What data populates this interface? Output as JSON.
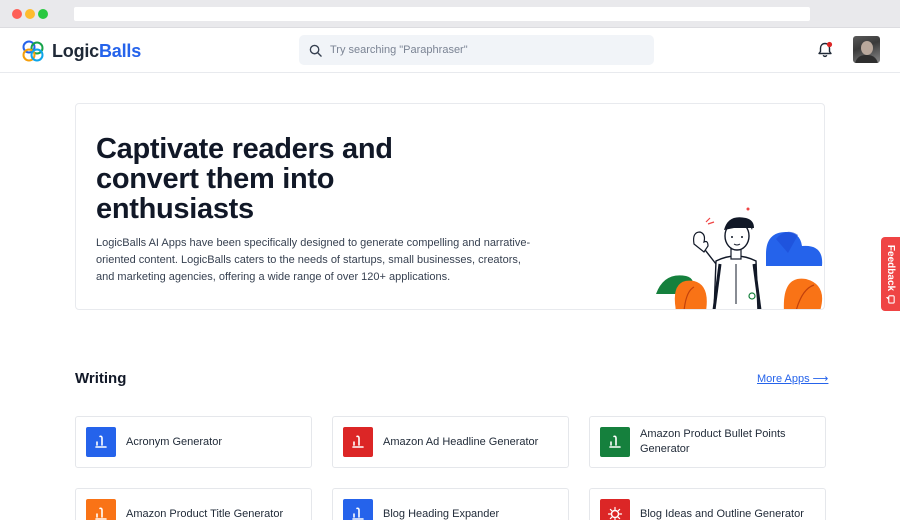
{
  "header": {
    "logo_prefix": "Logic",
    "logo_suffix": "Balls",
    "search_placeholder": "Try searching \"Paraphraser\""
  },
  "hero": {
    "title": "Captivate readers and convert them into enthusiasts",
    "description": "LogicBalls AI Apps have been specifically designed to generate compelling and narrative-oriented content. LogicBalls caters to the needs of startups, small businesses, creators, and marketing agencies, offering a wide range of over 120+ applications."
  },
  "feedback_label": "Feedback",
  "section": {
    "title": "Writing",
    "more_label": "More Apps ⟶"
  },
  "apps": [
    {
      "label": "Acronym Generator",
      "color": "#2563eb",
      "icon": "write-icon"
    },
    {
      "label": "Amazon Ad Headline Generator",
      "color": "#dc2626",
      "icon": "write-icon"
    },
    {
      "label": "Amazon Product Bullet Points Generator",
      "color": "#15803d",
      "icon": "write-icon"
    },
    {
      "label": "Amazon Product Title Generator",
      "color": "#f97316",
      "icon": "write-icon"
    },
    {
      "label": "Blog Heading Expander",
      "color": "#2563eb",
      "icon": "write-icon"
    },
    {
      "label": "Blog Ideas and Outline Generator",
      "color": "#dc2626",
      "icon": "bulb-icon"
    }
  ],
  "colors": {
    "brand": "#2563eb",
    "feedback": "#ef4444"
  }
}
